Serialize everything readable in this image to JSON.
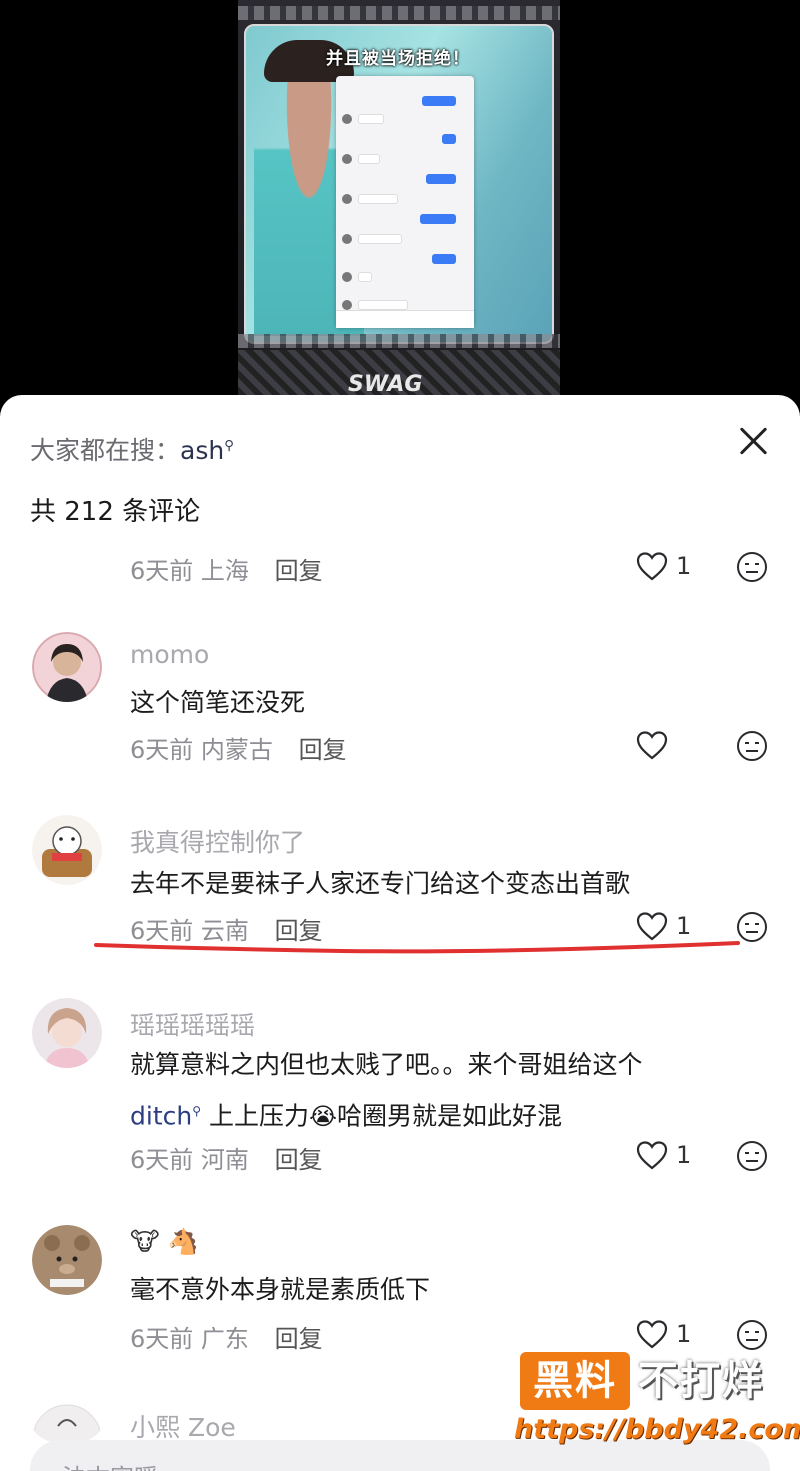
{
  "video": {
    "caption": "并且被当场拒绝！",
    "art_text": "SWAG"
  },
  "sheet": {
    "search_prefix": "大家都在搜：",
    "search_keyword": "ash",
    "comment_count_label": "共 212 条评论",
    "reply_label": "回复"
  },
  "comments": [
    {
      "username": "",
      "text": "",
      "time": "6天前",
      "location": "上海",
      "likes": "1"
    },
    {
      "username": "momo",
      "text": "这个简笔还没死",
      "time": "6天前",
      "location": "内蒙古",
      "likes": ""
    },
    {
      "username": "我真得控制你了",
      "text": "去年不是要袜子人家还专门给这个变态出首歌",
      "time": "6天前",
      "location": "云南",
      "likes": "1"
    },
    {
      "username": "瑶瑶瑶瑶瑶",
      "text_line1": "就算意料之内但也太贱了吧。。来个哥姐给这个",
      "keyword": "ditch",
      "text_line2": "上上压力",
      "text_line2b": "哈圈男就是如此好混",
      "time": "6天前",
      "location": "河南",
      "likes": "1"
    },
    {
      "username": "🐮 🐴",
      "text": "毫不意外本身就是素质低下",
      "time": "6天前",
      "location": "广东",
      "likes": "1"
    },
    {
      "username": "小熙 Zoe",
      "text": "",
      "time": "",
      "location": "",
      "likes": ""
    }
  ],
  "input": {
    "placeholder": "法古富暖",
    "partial": true
  },
  "watermark": {
    "box": "黑料",
    "side": "不打烊",
    "url": "https://bbdy42.com"
  },
  "colors": {
    "underline": "#e03030",
    "watermark_orange": "#f07a14"
  }
}
